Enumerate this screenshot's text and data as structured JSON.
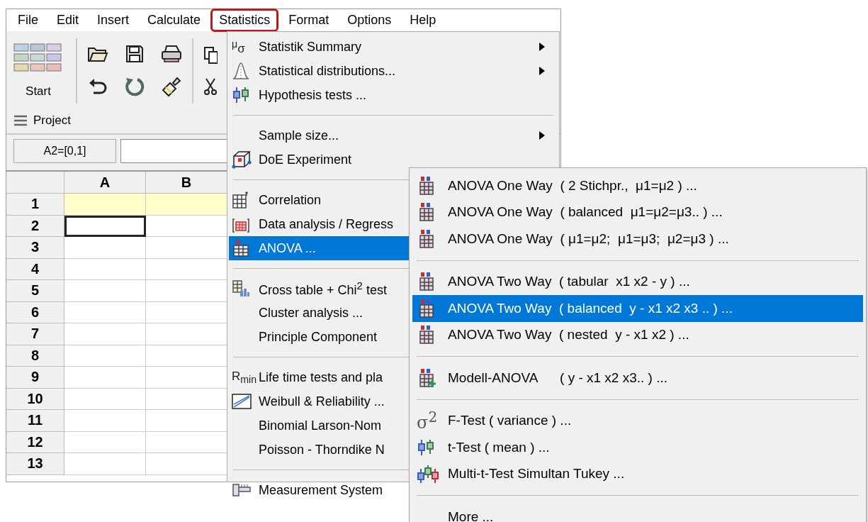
{
  "menubar": [
    {
      "label": "File",
      "selected": false
    },
    {
      "label": "Edit",
      "selected": false
    },
    {
      "label": "Insert",
      "selected": false
    },
    {
      "label": "Calculate",
      "selected": false
    },
    {
      "label": "Statistics",
      "selected": true
    },
    {
      "label": "Format",
      "selected": false
    },
    {
      "label": "Options",
      "selected": false
    },
    {
      "label": "Help",
      "selected": false
    }
  ],
  "toolbar": {
    "start_label": "Start",
    "project_label": "Project"
  },
  "formula_bar": {
    "cell_ref": "A2=[0,1]"
  },
  "grid": {
    "columns": [
      "A",
      "B"
    ],
    "rows": [
      {
        "label": "1",
        "cells": [
          {
            "highlighted": true,
            "selected": false
          },
          {
            "highlighted": true,
            "selected": false
          }
        ]
      },
      {
        "label": "2",
        "cells": [
          {
            "highlighted": false,
            "selected": true
          },
          {
            "highlighted": false,
            "selected": false
          }
        ]
      },
      {
        "label": "3",
        "cells": [
          {
            "highlighted": false,
            "selected": false
          },
          {
            "highlighted": false,
            "selected": false
          }
        ]
      },
      {
        "label": "4",
        "cells": [
          {
            "highlighted": false,
            "selected": false
          },
          {
            "highlighted": false,
            "selected": false
          }
        ]
      },
      {
        "label": "5",
        "cells": [
          {
            "highlighted": false,
            "selected": false
          },
          {
            "highlighted": false,
            "selected": false
          }
        ]
      },
      {
        "label": "6",
        "cells": [
          {
            "highlighted": false,
            "selected": false
          },
          {
            "highlighted": false,
            "selected": false
          }
        ]
      },
      {
        "label": "7",
        "cells": [
          {
            "highlighted": false,
            "selected": false
          },
          {
            "highlighted": false,
            "selected": false
          }
        ]
      },
      {
        "label": "8",
        "cells": [
          {
            "highlighted": false,
            "selected": false
          },
          {
            "highlighted": false,
            "selected": false
          }
        ]
      },
      {
        "label": "9",
        "cells": [
          {
            "highlighted": false,
            "selected": false
          },
          {
            "highlighted": false,
            "selected": false
          }
        ]
      },
      {
        "label": "10",
        "cells": [
          {
            "highlighted": false,
            "selected": false
          },
          {
            "highlighted": false,
            "selected": false
          }
        ]
      },
      {
        "label": "11",
        "cells": [
          {
            "highlighted": false,
            "selected": false
          },
          {
            "highlighted": false,
            "selected": false
          }
        ]
      },
      {
        "label": "12",
        "cells": [
          {
            "highlighted": false,
            "selected": false
          },
          {
            "highlighted": false,
            "selected": false
          }
        ]
      },
      {
        "label": "13",
        "cells": [
          {
            "highlighted": false,
            "selected": false
          },
          {
            "highlighted": false,
            "selected": false
          }
        ]
      }
    ]
  },
  "statistics_menu": {
    "groups": [
      [
        {
          "label": "Statistik Summary",
          "icon_text": "$^{μ}$σ",
          "kind": "symbol",
          "submenu": true,
          "selected": false
        },
        {
          "label": "Statistical distributions...",
          "kind": "distribution",
          "submenu": true,
          "selected": false
        },
        {
          "label": "Hypothesis tests ...",
          "kind": "boxplot",
          "submenu": false,
          "selected": false
        }
      ],
      [
        {
          "label": "Sample size...",
          "kind": "plain",
          "submenu": true,
          "selected": false
        },
        {
          "label": "DoE Experiment",
          "kind": "doe",
          "submenu": false,
          "selected": false
        }
      ],
      [
        {
          "label": "Correlation",
          "kind": "correlation",
          "selected": false
        },
        {
          "label": "Data analysis / Regress",
          "kind": "regression",
          "selected": false
        },
        {
          "label": "ANOVA ...",
          "kind": "table",
          "selected": true
        }
      ],
      [
        {
          "label": "Cross table + Chi$^{2}$ test",
          "kind": "crosstable",
          "selected": false
        },
        {
          "label": "Cluster analysis ...",
          "kind": "plain",
          "selected": false
        },
        {
          "label": "Principle Component",
          "kind": "plain",
          "selected": false
        }
      ],
      [
        {
          "label": "Life time tests and pla",
          "icon_text": "R$_{min}$",
          "kind": "symbol",
          "selected": false
        },
        {
          "label": "Weibull & Reliability ...",
          "kind": "weibull",
          "selected": false
        },
        {
          "label": "Binomial Larson-Nom",
          "kind": "plain",
          "selected": false
        },
        {
          "label": "Poisson - Thorndike N",
          "kind": "plain",
          "selected": false
        }
      ],
      [
        {
          "label": "Measurement System",
          "kind": "gauge",
          "selected": false
        }
      ]
    ]
  },
  "anova_submenu": {
    "groups": [
      [
        {
          "label": "ANOVA One Way  ( 2 Stichpr.,  μ1=μ2 ) ...",
          "kind": "table",
          "selected": false
        },
        {
          "label": "ANOVA One Way  ( balanced  μ1=μ2=μ3.. ) ...",
          "kind": "table",
          "selected": false
        },
        {
          "label": "ANOVA One Way  ( μ1=μ2;  μ1=μ3;  μ2=μ3 ) ...",
          "kind": "table",
          "selected": false
        }
      ],
      [
        {
          "label": "ANOVA Two Way  ( tabular  x1 x2 - y ) ...",
          "kind": "table",
          "selected": false
        },
        {
          "label": "ANOVA Two Way  ( balanced  y - x1 x2 x3 .. ) ...",
          "kind": "table",
          "selected": true
        },
        {
          "label": "ANOVA Two Way  ( nested  y - x1 x2 ) ...",
          "kind": "table",
          "selected": false
        }
      ],
      [
        {
          "label": "Modell-ANOVA      ( y - x1 x2 x3.. ) ...",
          "kind": "table-plus",
          "selected": false
        }
      ],
      [
        {
          "label": "F-Test ( variance ) ...",
          "icon_text": "σ$^{2}$",
          "kind": "symbol",
          "selected": false
        },
        {
          "label": "t-Test ( mean ) ...",
          "kind": "boxplot",
          "selected": false
        },
        {
          "label": "Multi-t-Test Simultan Tukey ...",
          "kind": "boxplot3",
          "selected": false
        }
      ],
      [
        {
          "label": "More ...",
          "kind": "plain",
          "selected": false
        }
      ]
    ]
  }
}
